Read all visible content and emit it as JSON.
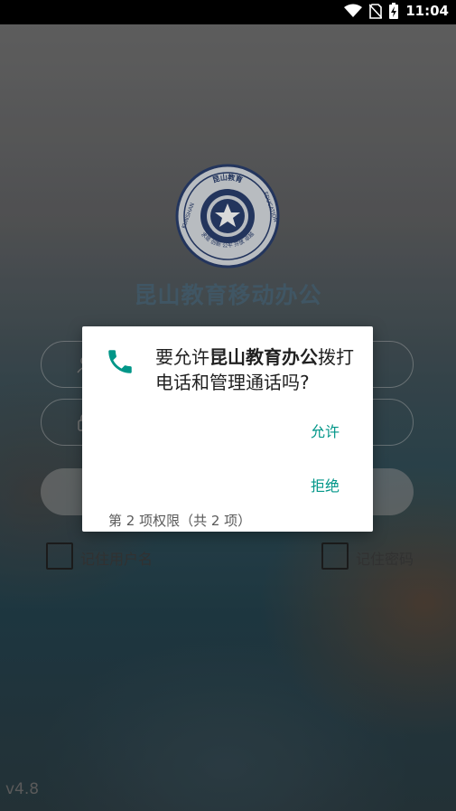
{
  "status_bar": {
    "time": "11:04",
    "icons": [
      "wifi-icon",
      "no-sim-icon",
      "battery-charging-icon"
    ]
  },
  "app": {
    "logo_text_top": "昆山教育",
    "logo_text_left": "KUNSHAN",
    "logo_text_right": "EDUCATION",
    "logo_text_bottom": "求是 创新 公平 开放 卓越",
    "title": "昆山教育移动办公",
    "remember_user_label": "记住用户名",
    "remember_password_label": "记住密码",
    "version": "v4.8"
  },
  "dialog": {
    "message_prefix": "要允许",
    "app_name": "昆山教育办公",
    "message_suffix": "拨打电话和管理通话吗?",
    "allow_label": "允许",
    "deny_label": "拒绝",
    "counter": "第 2 项权限（共 2 项）"
  },
  "colors": {
    "accent": "#009688",
    "title": "#4c6676",
    "logo": "#2a3f6e"
  }
}
